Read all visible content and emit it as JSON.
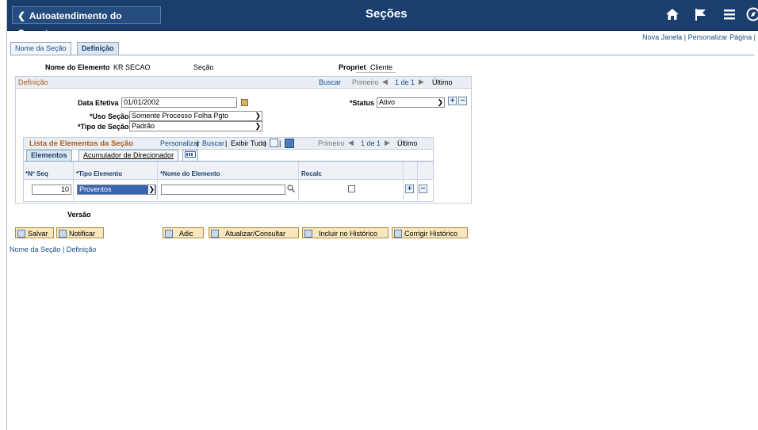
{
  "header": {
    "back_label": "Autoatendimento do Gerente",
    "page_title": "Seções",
    "back_icon": "chevron-left-icon",
    "icons": [
      "home-icon",
      "flag-icon",
      "menu-icon",
      "navbar-icon"
    ]
  },
  "top_links": {
    "new_window": "Nova Janela",
    "separator": "|",
    "personalize_page": "Personalizar Página",
    "separator2": "|"
  },
  "tabs": [
    {
      "label": "Nome da Seção",
      "active": false
    },
    {
      "label": "Definição",
      "active": true
    }
  ],
  "element_info": {
    "name_label": "Nome do Elemento",
    "name_value": "KR SECAO",
    "type_value": "Seção",
    "owner_label": "Propriet",
    "owner_value": "Cliente"
  },
  "definition": {
    "title": "Definição",
    "nav": {
      "search": "Buscar",
      "first": "Primeiro",
      "count": "1 de 1",
      "last": "Último"
    },
    "effective_date_label": "Data Efetiva",
    "effective_date_value": "01/01/2002",
    "status_label": "*Status",
    "status_value": "Ativo",
    "use_label": "*Uso Seção",
    "use_value": "Somente Processo Folha Pgto",
    "type_label": "*Tipo de Seção",
    "type_value": "Padrão"
  },
  "elements_list": {
    "title": "Lista de Elementos da Seção",
    "personalize": "Personalizar",
    "search": "Buscar",
    "view_all": "Exibir Tudo",
    "first": "Primeiro",
    "count": "1 de 1",
    "last": "Último",
    "subtabs": [
      {
        "label": "Elementos",
        "active": true
      },
      {
        "label": "Acumulador de Direcionador",
        "active": false
      }
    ],
    "columns": [
      "*Nº Seq",
      "*Tipo Elemento",
      "*Nome do Elemento",
      "Recalc"
    ],
    "rows": [
      {
        "seq": "10",
        "type": "Proventos",
        "name": "",
        "recalc": false
      }
    ]
  },
  "version_label": "Versão",
  "buttons": {
    "save": "Salvar",
    "notify": "Notificar",
    "add": "Adic",
    "update": "Atualizar/Consultar",
    "include_history": "Incluir no Histórico",
    "correct_history": "Corrigir Histórico"
  },
  "bottom_links": {
    "section_name": "Nome da Seção",
    "separator": "|",
    "definition": "Definição"
  },
  "colors": {
    "header_bg": "#1a3f6f",
    "link": "#1a4f8a",
    "group_title": "#b05a14",
    "button_bg": "#f7e7bf"
  }
}
